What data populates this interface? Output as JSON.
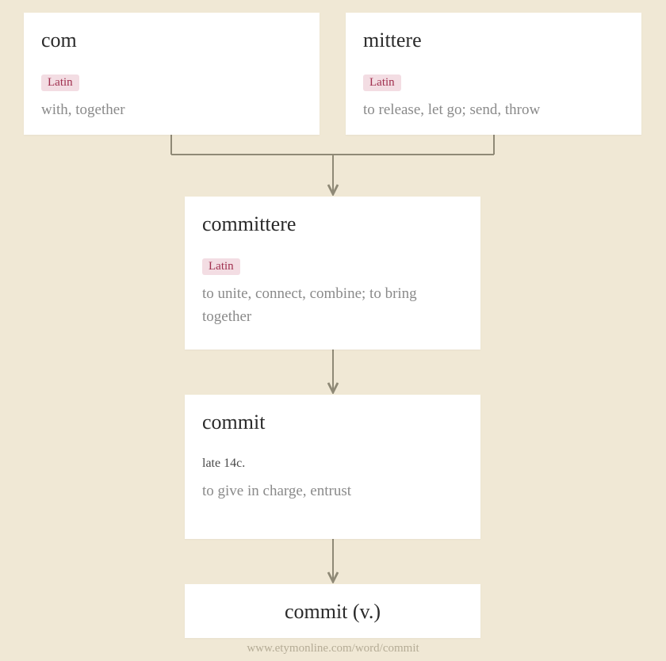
{
  "nodes": {
    "com": {
      "title": "com",
      "language": "Latin",
      "definition": "with, together"
    },
    "mittere": {
      "title": "mittere",
      "language": "Latin",
      "definition": "to release, let go; send, throw"
    },
    "committere": {
      "title": "committere",
      "language": "Latin",
      "definition": "to unite, connect, combine; to bring together"
    },
    "commit": {
      "title": "commit",
      "date": "late 14c.",
      "definition": "to give in charge, entrust"
    },
    "final": {
      "title": "commit (v.)"
    }
  },
  "attribution": "www.etymonline.com/word/commit"
}
